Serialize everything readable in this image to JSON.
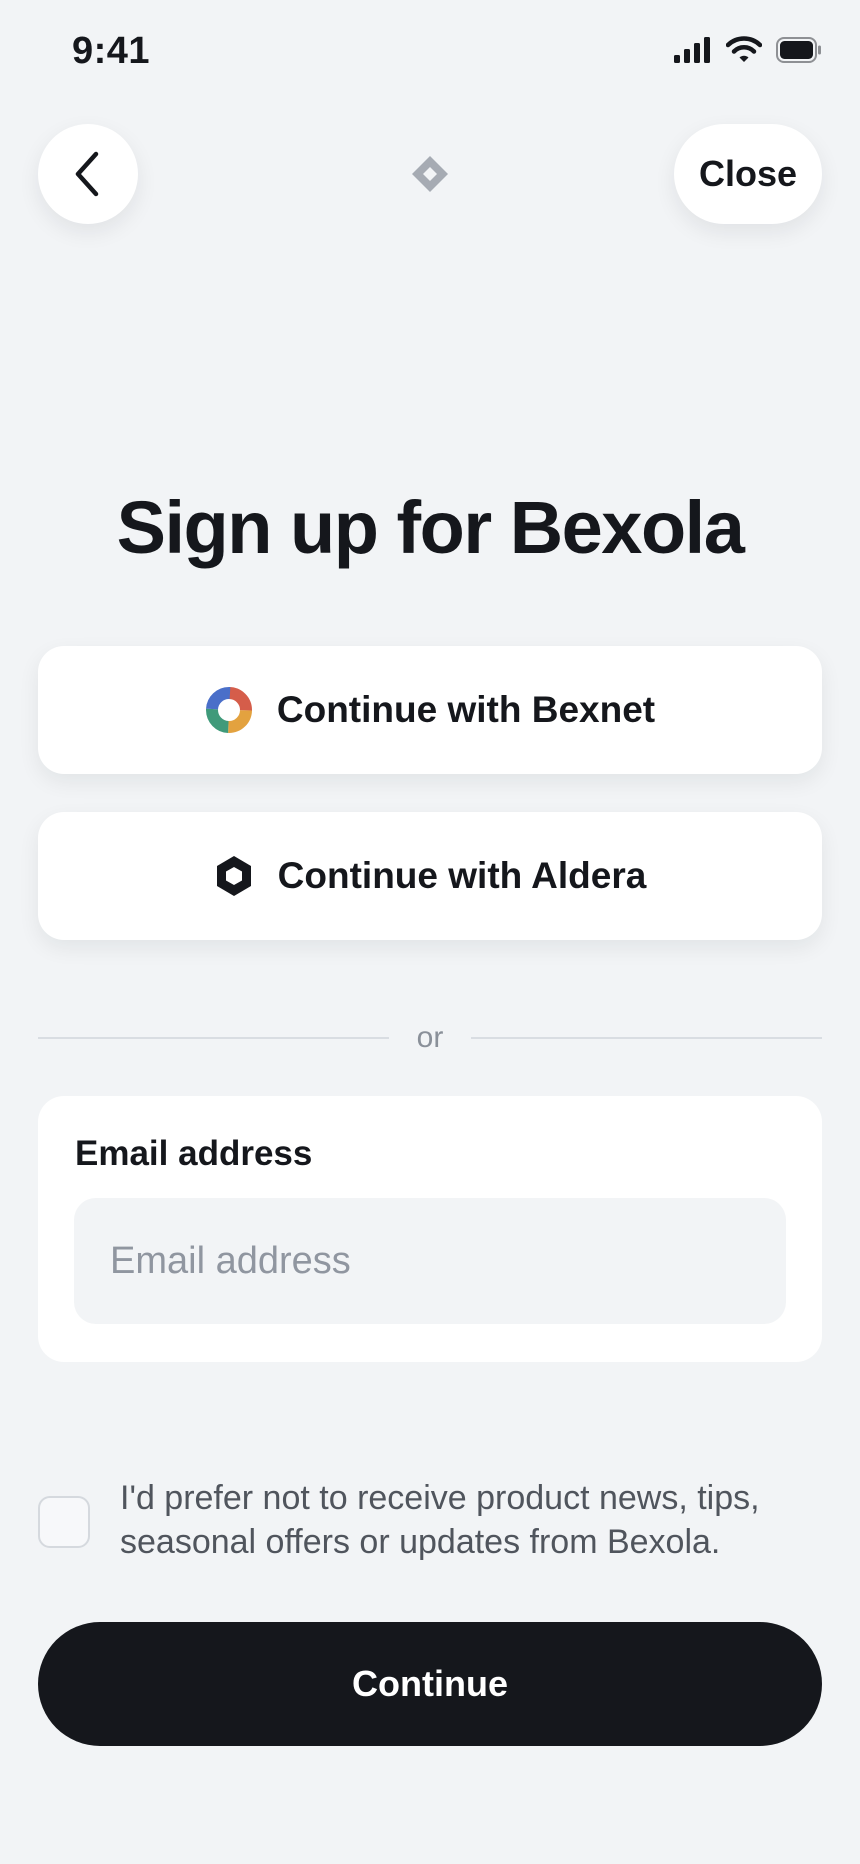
{
  "status_bar": {
    "time": "9:41",
    "icons": [
      "signal-icon",
      "wifi-icon",
      "battery-icon"
    ]
  },
  "header": {
    "back_icon": "chevron-left-icon",
    "logo_icon": "diamond-logo-icon",
    "close_label": "Close"
  },
  "title": "Sign up for Bexola",
  "providers": [
    {
      "label": "Continue with Bexnet",
      "icon": "bexnet-ring-icon"
    },
    {
      "label": "Continue with Aldera",
      "icon": "aldera-hexagon-icon"
    }
  ],
  "divider_text": "or",
  "email": {
    "label": "Email address",
    "placeholder": "Email address",
    "value": ""
  },
  "opt_out": {
    "line1": "I'd prefer not to receive product news, tips,",
    "line2": "seasonal offers or updates from Bexola.",
    "checked": false
  },
  "continue_label": "Continue",
  "colors": {
    "background": "#f2f4f6",
    "primary": "#15171c",
    "card": "#ffffff",
    "muted_text": "#8a9099"
  }
}
